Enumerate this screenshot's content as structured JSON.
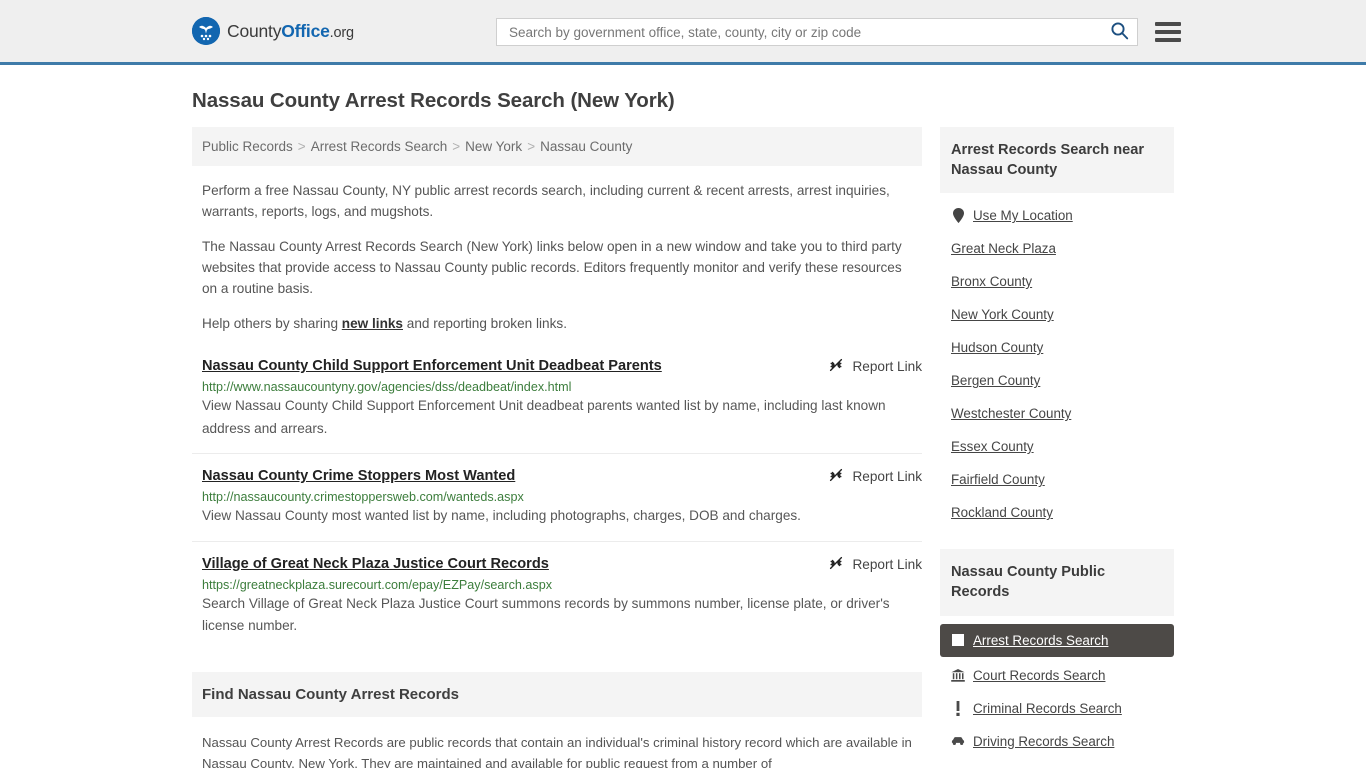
{
  "header": {
    "logo": {
      "icon": "eagle-seal-icon",
      "text_part1": "County",
      "text_part2": "Office",
      "text_part3": ".org"
    },
    "search": {
      "placeholder": "Search by government office, state, county, city or zip code",
      "value": "",
      "search_icon": "search-icon",
      "menu_icon": "hamburger-menu-icon"
    },
    "accent_color": "#3f7ba9",
    "background_color": "#efefef"
  },
  "page_title": "Nassau County Arrest Records Search (New York)",
  "breadcrumb": {
    "items": [
      {
        "label": "Public Records"
      },
      {
        "label": "Arrest Records Search"
      },
      {
        "label": "New York"
      },
      {
        "label": "Nassau County"
      }
    ],
    "separator": ">"
  },
  "intro": {
    "p1": "Perform a free Nassau County, NY public arrest records search, including current & recent arrests, arrest inquiries, warrants, reports, logs, and mugshots.",
    "p2": "The Nassau County Arrest Records Search (New York) links below open in a new window and take you to third party websites that provide access to Nassau County public records. Editors frequently monitor and verify these resources on a routine basis.",
    "p3_before": "Help others by sharing ",
    "p3_link": "new links",
    "p3_after": " and reporting broken links."
  },
  "results": {
    "report_label": "Report Link",
    "report_icon": "broken-link-icon",
    "items": [
      {
        "title": "Nassau County Child Support Enforcement Unit Deadbeat Parents",
        "url": "http://www.nassaucountyny.gov/agencies/dss/deadbeat/index.html",
        "description": "View Nassau County Child Support Enforcement Unit deadbeat parents wanted list by name, including last known address and arrears."
      },
      {
        "title": "Nassau County Crime Stoppers Most Wanted",
        "url": "http://nassaucounty.crimestoppersweb.com/wanteds.aspx",
        "description": "View Nassau County most wanted list by name, including photographs, charges, DOB and charges."
      },
      {
        "title": "Village of Great Neck Plaza Justice Court Records",
        "url": "https://greatneckplaza.surecourt.com/epay/EZPay/search.aspx",
        "description": "Search Village of Great Neck Plaza Justice Court summons records by summons number, license plate, or driver's license number."
      }
    ]
  },
  "find_section": {
    "heading": "Find Nassau County Arrest Records",
    "body": "Nassau County Arrest Records are public records that contain an individual's criminal history record which are available in Nassau County, New York. They are maintained and available for public request from a number of"
  },
  "sidebar": {
    "nearby": {
      "heading": "Arrest Records Search near Nassau County",
      "items": [
        {
          "label": "Use My Location",
          "icon": "map-pin-icon"
        },
        {
          "label": "Great Neck Plaza",
          "icon": ""
        },
        {
          "label": "Bronx County",
          "icon": ""
        },
        {
          "label": "New York County",
          "icon": ""
        },
        {
          "label": "Hudson County",
          "icon": ""
        },
        {
          "label": "Bergen County",
          "icon": ""
        },
        {
          "label": "Westchester County",
          "icon": ""
        },
        {
          "label": "Essex County",
          "icon": ""
        },
        {
          "label": "Fairfield County",
          "icon": ""
        },
        {
          "label": "Rockland County",
          "icon": ""
        }
      ]
    },
    "public_records": {
      "heading": "Nassau County Public Records",
      "active_background": "#4d4a47",
      "items": [
        {
          "label": "Arrest Records Search",
          "icon": "white-square-icon",
          "active": true
        },
        {
          "label": "Court Records Search",
          "icon": "courthouse-icon",
          "active": false
        },
        {
          "label": "Criminal Records Search",
          "icon": "exclamation-icon",
          "active": false
        },
        {
          "label": "Driving Records Search",
          "icon": "car-icon",
          "active": false
        }
      ]
    }
  }
}
